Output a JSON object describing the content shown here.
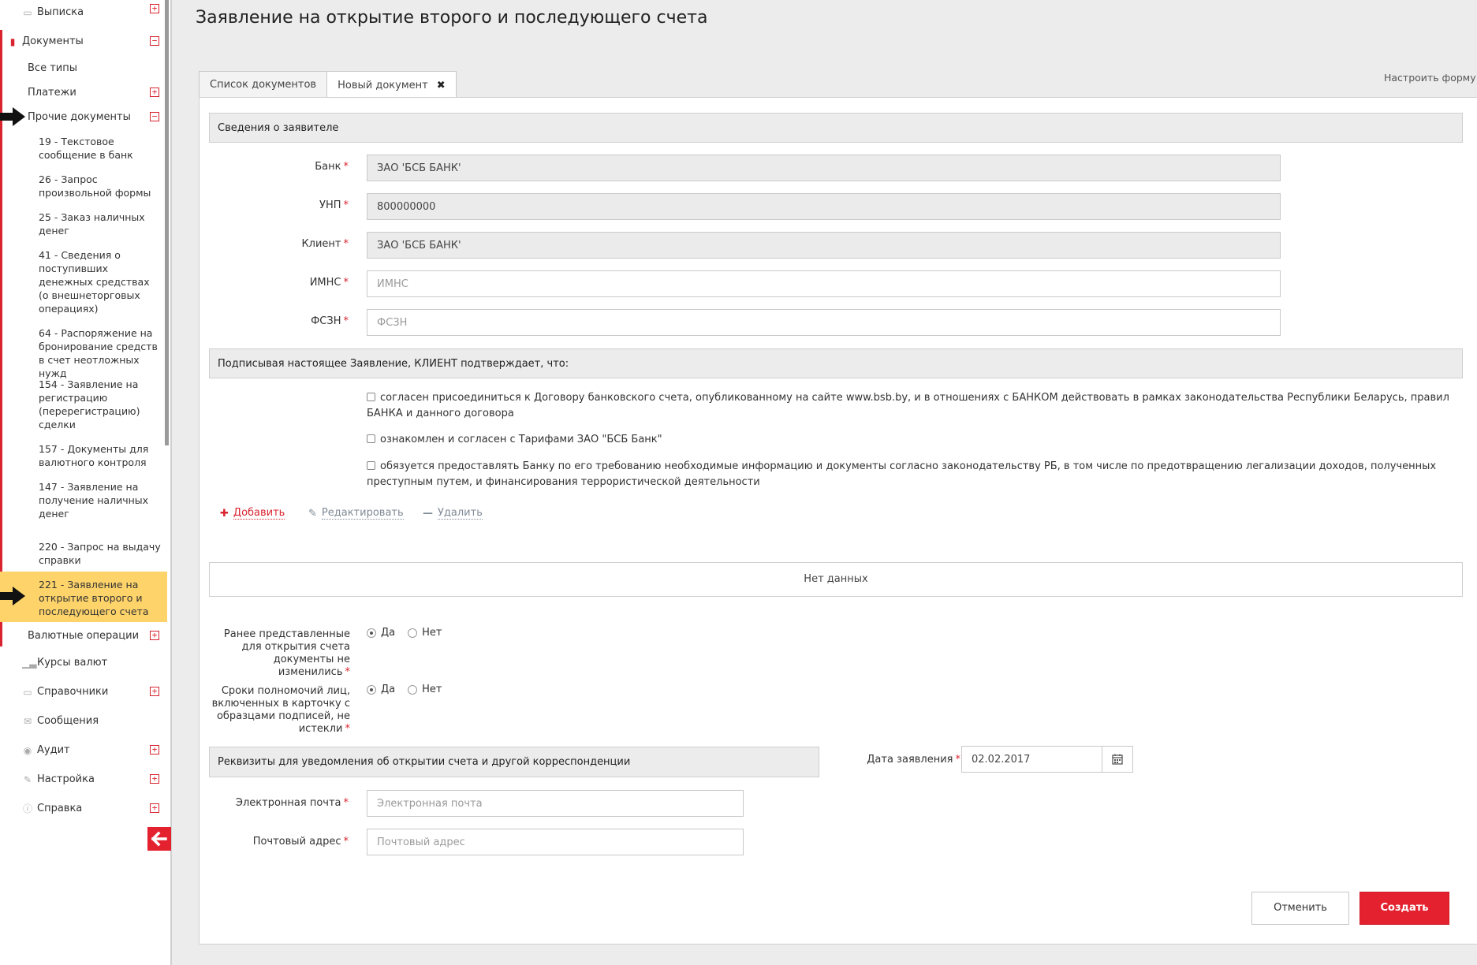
{
  "page": {
    "title": "Заявление на открытие второго и последующего счета"
  },
  "sidebar": {
    "vypiska": "Выписка",
    "documents": "Документы",
    "all_types": "Все типы",
    "payments": "Платежи",
    "other_docs": "Прочие документы",
    "doc_items": [
      "19 - Текстовое сообщение в банк",
      "26 - Запрос произвольной формы",
      "25 - Заказ наличных денег",
      "41 - Сведения о поступивших денежных средствах (о внешнеторговых операциях)",
      "64 - Распоряжение на бронирование средств в счет неотложных нужд",
      "154 - Заявление на регистрацию (перерегистрацию) сделки",
      "157 - Документы для валютного контроля",
      "147 - Заявление на получение наличных денег",
      "220 - Запрос на выдачу справки",
      "221 - Заявление на открытие второго и последующего счета"
    ],
    "currency_ops": "Валютные операции",
    "rates": "Курсы валют",
    "directories": "Справочники",
    "messages": "Сообщения",
    "audit": "Аудит",
    "settings": "Настройка",
    "help": "Справка",
    "plus": "+",
    "minus": "−"
  },
  "tabs": {
    "list": "Список документов",
    "new": "Новый документ",
    "close": "✖"
  },
  "customize_form": "Настроить форму",
  "applicant": {
    "header": "Сведения о заявителе",
    "bank_label": "Банк",
    "bank_value": "ЗАО 'БСБ БАНК'",
    "unp_label": "УНП",
    "unp_value": "800000000",
    "client_label": "Клиент",
    "client_value": "ЗАО 'БСБ БАНК'",
    "imns_label": "ИМНС",
    "imns_placeholder": "ИМНС",
    "fszn_label": "ФСЗН",
    "fszn_placeholder": "ФСЗН",
    "required_mark": "*"
  },
  "confirm": {
    "header": "Подписывая настоящее Заявление, КЛИЕНТ подтверждает, что:",
    "items": [
      "согласен присоединиться к Договору банковского счета, опубликованному на сайте www.bsb.by, и в отношениях с БАНКОМ действовать в рамках законодательства Республики Беларусь, правил БАНКА и данного договора",
      "ознакомлен и согласен с Тарифами ЗАО \"БСБ Банк\"",
      "обязуется предоставлять Банку по его требованию необходимые информацию и документы согласно законодательству РБ, в том числе по предотвращению легализации доходов, полученных преступным путем, и финансирования террористической деятельности"
    ]
  },
  "actions": {
    "add": "Добавить",
    "edit": "Редактировать",
    "delete": "Удалить"
  },
  "no_data": "Нет данных",
  "questions": {
    "q1": "Ранее представленные для открытия счета документы не изменились",
    "q2": "Сроки полномочий лиц, включенных в карточку с образцами подписей, не истекли",
    "yes": "Да",
    "no": "Нет",
    "q1_selected": "Да",
    "q2_selected": "Да"
  },
  "notify": {
    "header": "Реквизиты для уведомления об открытии счета и другой корреспонденции",
    "email_label": "Электронная почта",
    "email_placeholder": "Электронная почта",
    "address_label": "Почтовый адрес",
    "address_placeholder": "Почтовый адрес",
    "date_label": "Дата заявления",
    "date_value": "02.02.2017"
  },
  "buttons": {
    "cancel": "Отменить",
    "create": "Создать"
  },
  "colors": {
    "accent": "#e3212f",
    "highlight": "#fdd36a"
  }
}
